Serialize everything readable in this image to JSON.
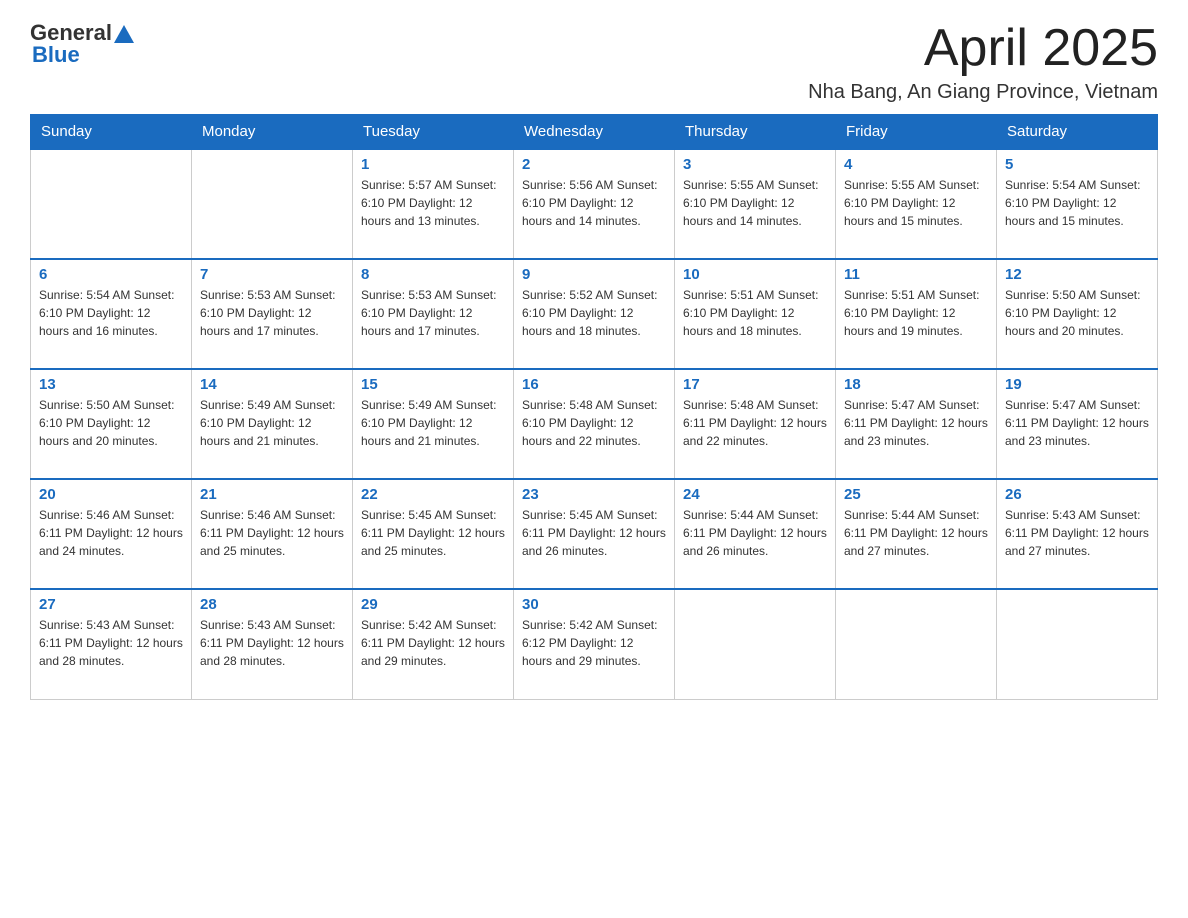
{
  "header": {
    "logo_general": "General",
    "logo_blue": "Blue",
    "month_title": "April 2025",
    "location": "Nha Bang, An Giang Province, Vietnam"
  },
  "weekdays": [
    "Sunday",
    "Monday",
    "Tuesday",
    "Wednesday",
    "Thursday",
    "Friday",
    "Saturday"
  ],
  "weeks": [
    [
      {
        "day": "",
        "info": ""
      },
      {
        "day": "",
        "info": ""
      },
      {
        "day": "1",
        "info": "Sunrise: 5:57 AM\nSunset: 6:10 PM\nDaylight: 12 hours\nand 13 minutes."
      },
      {
        "day": "2",
        "info": "Sunrise: 5:56 AM\nSunset: 6:10 PM\nDaylight: 12 hours\nand 14 minutes."
      },
      {
        "day": "3",
        "info": "Sunrise: 5:55 AM\nSunset: 6:10 PM\nDaylight: 12 hours\nand 14 minutes."
      },
      {
        "day": "4",
        "info": "Sunrise: 5:55 AM\nSunset: 6:10 PM\nDaylight: 12 hours\nand 15 minutes."
      },
      {
        "day": "5",
        "info": "Sunrise: 5:54 AM\nSunset: 6:10 PM\nDaylight: 12 hours\nand 15 minutes."
      }
    ],
    [
      {
        "day": "6",
        "info": "Sunrise: 5:54 AM\nSunset: 6:10 PM\nDaylight: 12 hours\nand 16 minutes."
      },
      {
        "day": "7",
        "info": "Sunrise: 5:53 AM\nSunset: 6:10 PM\nDaylight: 12 hours\nand 17 minutes."
      },
      {
        "day": "8",
        "info": "Sunrise: 5:53 AM\nSunset: 6:10 PM\nDaylight: 12 hours\nand 17 minutes."
      },
      {
        "day": "9",
        "info": "Sunrise: 5:52 AM\nSunset: 6:10 PM\nDaylight: 12 hours\nand 18 minutes."
      },
      {
        "day": "10",
        "info": "Sunrise: 5:51 AM\nSunset: 6:10 PM\nDaylight: 12 hours\nand 18 minutes."
      },
      {
        "day": "11",
        "info": "Sunrise: 5:51 AM\nSunset: 6:10 PM\nDaylight: 12 hours\nand 19 minutes."
      },
      {
        "day": "12",
        "info": "Sunrise: 5:50 AM\nSunset: 6:10 PM\nDaylight: 12 hours\nand 20 minutes."
      }
    ],
    [
      {
        "day": "13",
        "info": "Sunrise: 5:50 AM\nSunset: 6:10 PM\nDaylight: 12 hours\nand 20 minutes."
      },
      {
        "day": "14",
        "info": "Sunrise: 5:49 AM\nSunset: 6:10 PM\nDaylight: 12 hours\nand 21 minutes."
      },
      {
        "day": "15",
        "info": "Sunrise: 5:49 AM\nSunset: 6:10 PM\nDaylight: 12 hours\nand 21 minutes."
      },
      {
        "day": "16",
        "info": "Sunrise: 5:48 AM\nSunset: 6:10 PM\nDaylight: 12 hours\nand 22 minutes."
      },
      {
        "day": "17",
        "info": "Sunrise: 5:48 AM\nSunset: 6:11 PM\nDaylight: 12 hours\nand 22 minutes."
      },
      {
        "day": "18",
        "info": "Sunrise: 5:47 AM\nSunset: 6:11 PM\nDaylight: 12 hours\nand 23 minutes."
      },
      {
        "day": "19",
        "info": "Sunrise: 5:47 AM\nSunset: 6:11 PM\nDaylight: 12 hours\nand 23 minutes."
      }
    ],
    [
      {
        "day": "20",
        "info": "Sunrise: 5:46 AM\nSunset: 6:11 PM\nDaylight: 12 hours\nand 24 minutes."
      },
      {
        "day": "21",
        "info": "Sunrise: 5:46 AM\nSunset: 6:11 PM\nDaylight: 12 hours\nand 25 minutes."
      },
      {
        "day": "22",
        "info": "Sunrise: 5:45 AM\nSunset: 6:11 PM\nDaylight: 12 hours\nand 25 minutes."
      },
      {
        "day": "23",
        "info": "Sunrise: 5:45 AM\nSunset: 6:11 PM\nDaylight: 12 hours\nand 26 minutes."
      },
      {
        "day": "24",
        "info": "Sunrise: 5:44 AM\nSunset: 6:11 PM\nDaylight: 12 hours\nand 26 minutes."
      },
      {
        "day": "25",
        "info": "Sunrise: 5:44 AM\nSunset: 6:11 PM\nDaylight: 12 hours\nand 27 minutes."
      },
      {
        "day": "26",
        "info": "Sunrise: 5:43 AM\nSunset: 6:11 PM\nDaylight: 12 hours\nand 27 minutes."
      }
    ],
    [
      {
        "day": "27",
        "info": "Sunrise: 5:43 AM\nSunset: 6:11 PM\nDaylight: 12 hours\nand 28 minutes."
      },
      {
        "day": "28",
        "info": "Sunrise: 5:43 AM\nSunset: 6:11 PM\nDaylight: 12 hours\nand 28 minutes."
      },
      {
        "day": "29",
        "info": "Sunrise: 5:42 AM\nSunset: 6:11 PM\nDaylight: 12 hours\nand 29 minutes."
      },
      {
        "day": "30",
        "info": "Sunrise: 5:42 AM\nSunset: 6:12 PM\nDaylight: 12 hours\nand 29 minutes."
      },
      {
        "day": "",
        "info": ""
      },
      {
        "day": "",
        "info": ""
      },
      {
        "day": "",
        "info": ""
      }
    ]
  ]
}
